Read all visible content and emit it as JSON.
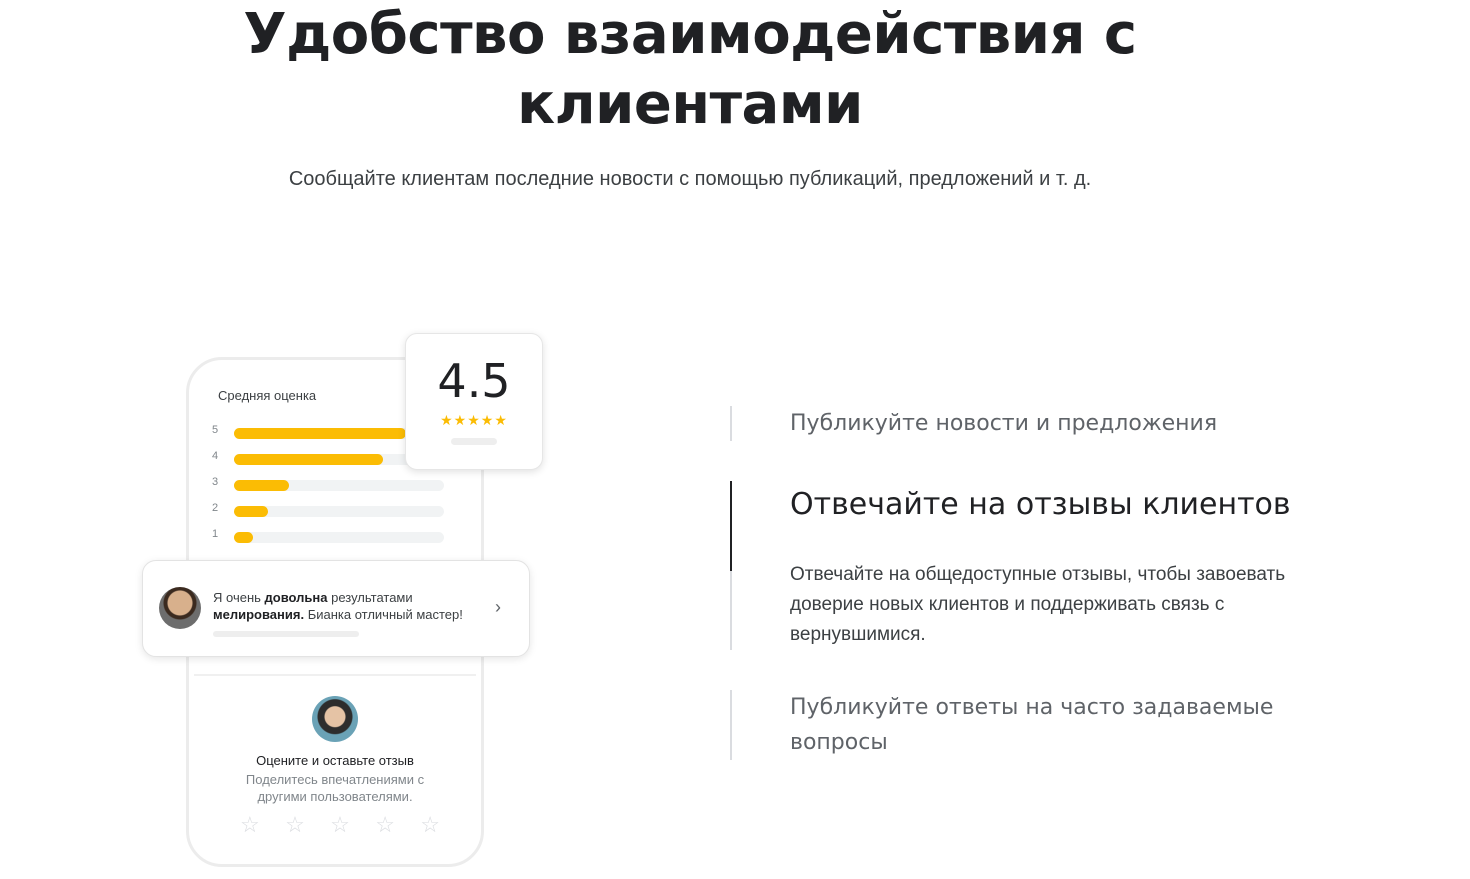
{
  "hero": {
    "title_line1": "Удобство взаимодействия с",
    "title_line2": "клиентами",
    "subtitle": "Сообщайте клиентам последние новости с помощью публикаций, предложений и т. д."
  },
  "mockup": {
    "average_label": "Средняя оценка",
    "rating_value": "4.5",
    "rating_stars": "★★★★★",
    "rating_breakdown": [
      {
        "stars": "5",
        "fraction": 0.82
      },
      {
        "stars": "4",
        "fraction": 0.71
      },
      {
        "stars": "3",
        "fraction": 0.26
      },
      {
        "stars": "2",
        "fraction": 0.16
      },
      {
        "stars": "1",
        "fraction": 0.09
      }
    ],
    "review": {
      "part1": "Я очень ",
      "bold1": "довольна",
      "part2": " результатами ",
      "bold2": "мелирования.",
      "part3": " Бианка отличный мастер!",
      "chevron": "›"
    },
    "rate": {
      "title": "Оцените и оставьте отзыв",
      "description": "Поделитесь впечатлениями с другими пользователями.",
      "star_glyph": "☆"
    }
  },
  "features": {
    "items": [
      {
        "title": "Публикуйте новости и предложения"
      },
      {
        "title": "Отвечайте на отзывы клиентов",
        "description": "Отвечайте на общедоступные отзывы, чтобы завоевать доверие новых клиентов и поддерживать связь с вернувшимися."
      },
      {
        "title": "Публикуйте ответы на часто задаваемые вопросы"
      }
    ]
  },
  "colors": {
    "accent_yellow": "#fbbc04",
    "text_dark": "#202124",
    "text_muted": "#5f6368"
  }
}
